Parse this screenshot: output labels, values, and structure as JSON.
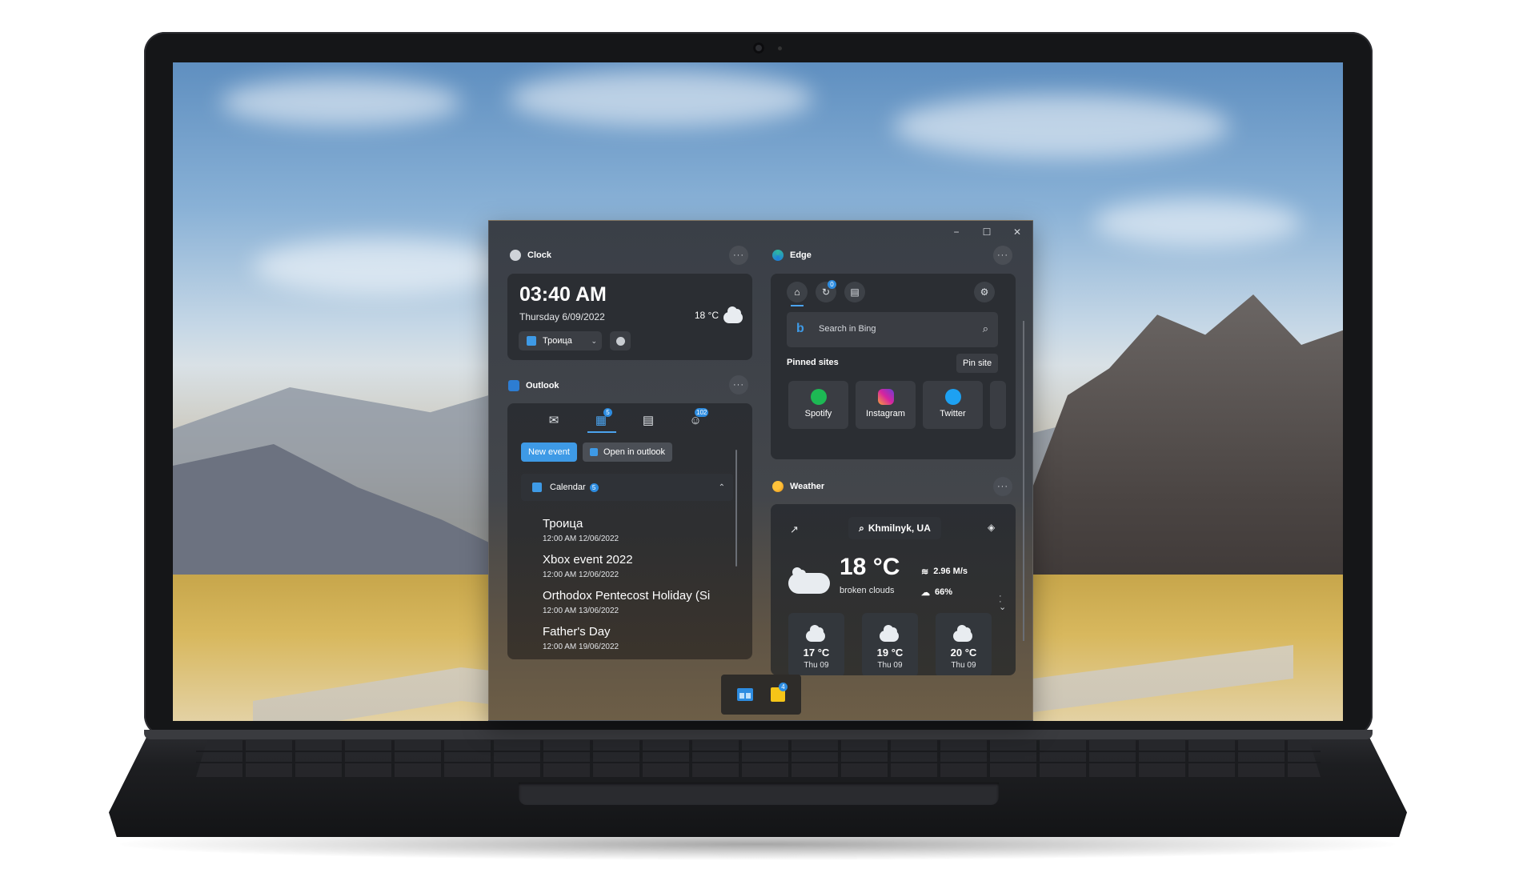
{
  "window": {
    "controls": {
      "minimize": "−",
      "maximize": "☐",
      "close": "✕"
    }
  },
  "clock": {
    "title": "Clock",
    "more": "···",
    "time": "03:40 AM",
    "date": "Thursday 6/09/2022",
    "temperature": "18 °C",
    "event_selector": "Троица",
    "icon": "clock-icon"
  },
  "outlook": {
    "title": "Outlook",
    "more": "···",
    "tabs": [
      {
        "name": "mail",
        "icon": "mail-icon"
      },
      {
        "name": "calendar",
        "icon": "calendar-icon",
        "badge": "5",
        "selected": true
      },
      {
        "name": "month",
        "icon": "calendar-grid-icon"
      },
      {
        "name": "people",
        "icon": "people-icon",
        "badge": "102"
      }
    ],
    "new_event": "New event",
    "open_in_outlook": "Open in outlook",
    "calendar_label": "Calendar",
    "calendar_badge": "5",
    "events": [
      {
        "title": "Троица",
        "date": "12:00 AM 12/06/2022"
      },
      {
        "title": "Xbox event 2022",
        "date": "12:00 AM 12/06/2022"
      },
      {
        "title": "Orthodox Pentecost Holiday (Si",
        "date": "12:00 AM 13/06/2022"
      },
      {
        "title": "Father's Day",
        "date": "12:00 AM 19/06/2022"
      }
    ]
  },
  "edge": {
    "title": "Edge",
    "more": "···",
    "tabs_badge": "0",
    "search_placeholder": "Search in Bing",
    "pinned_label": "Pinned sites",
    "pin_site": "Pin site",
    "sites": [
      {
        "name": "Spotify",
        "color": "#1db954"
      },
      {
        "name": "Instagram",
        "color": "#d6249f"
      },
      {
        "name": "Twitter",
        "color": "#1da1f2"
      }
    ]
  },
  "weather": {
    "title": "Weather",
    "more": "···",
    "location": "Khmilnyk, UA",
    "temperature": "18 °C",
    "condition": "broken clouds",
    "wind": "2.96  M/s",
    "humidity": "66%",
    "forecast": [
      {
        "temp": "17 °C",
        "day": "Thu 09"
      },
      {
        "temp": "19 °C",
        "day": "Thu 09"
      },
      {
        "temp": "20 °C",
        "day": "Thu 09"
      }
    ]
  },
  "dock": {
    "notes_badge": "4"
  },
  "colors": {
    "accent": "#3e9ae6",
    "window_bg": "#3a3f47",
    "card_bg": "#2b2e33",
    "laptop": "#151618"
  }
}
